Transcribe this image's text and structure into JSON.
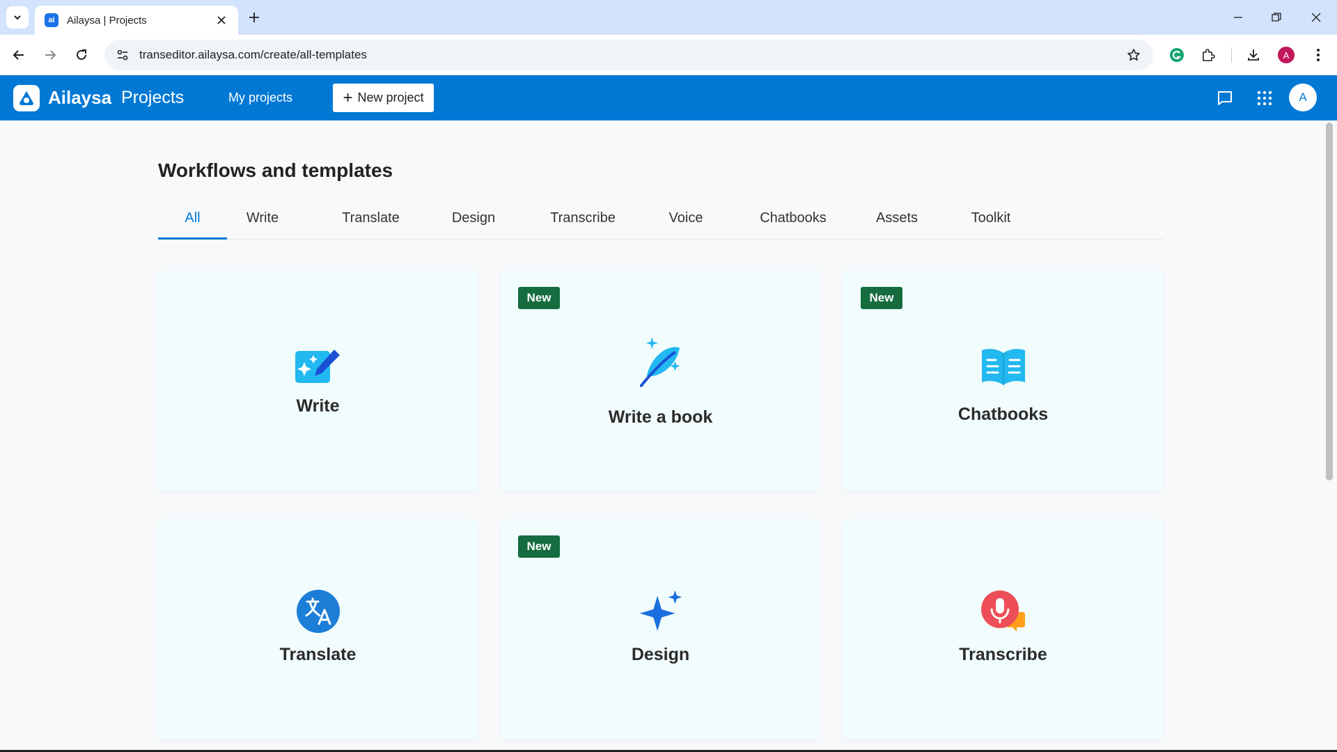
{
  "browser": {
    "tab_title": "Ailaysa | Projects",
    "favicon_text": "ai",
    "url": "transeditor.ailaysa.com/create/all-templates",
    "profile_initial": "A"
  },
  "header": {
    "brand": "Ailaysa",
    "brand_sub": "Projects",
    "my_projects_label": "My projects",
    "new_project_label": "New project",
    "user_initial": "A"
  },
  "content": {
    "title": "Workflows and templates",
    "tabs": [
      "All",
      "Write",
      "Translate",
      "Design",
      "Transcribe",
      "Voice",
      "Chatbooks",
      "Assets",
      "Toolkit"
    ],
    "active_tab": "All",
    "cards": [
      {
        "label": "Write",
        "badge": "",
        "icon": "write-icon"
      },
      {
        "label": "Write a book",
        "badge": "New",
        "icon": "feather-icon"
      },
      {
        "label": "Chatbooks",
        "badge": "New",
        "icon": "open-book-icon"
      },
      {
        "label": "Translate",
        "badge": "",
        "icon": "translate-icon"
      },
      {
        "label": "Design",
        "badge": "New",
        "icon": "sparkle-icon"
      },
      {
        "label": "Transcribe",
        "badge": "",
        "icon": "microphone-icon"
      }
    ]
  },
  "colors": {
    "header_bg": "#0078d4",
    "card_bg": "#f1fcfc",
    "badge_bg": "#156d3f",
    "active_tab": "#0078d4"
  }
}
